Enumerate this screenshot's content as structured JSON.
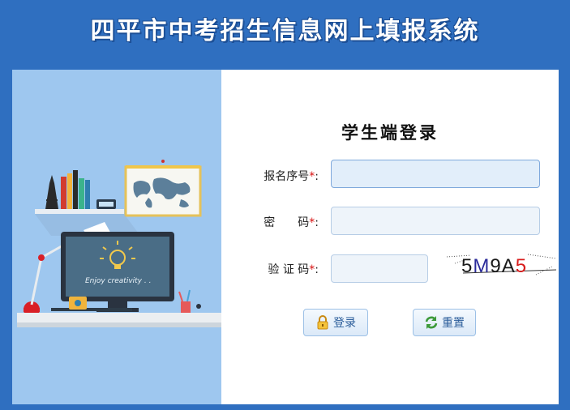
{
  "page": {
    "title": "四平市中考招生信息网上填报系统"
  },
  "illustration": {
    "monitor_text": "Enjoy creativity . ."
  },
  "login": {
    "title": "学生端登录",
    "fields": {
      "reg_no": {
        "label": "报名序号",
        "required_mark": "*",
        "suffix": ":",
        "value": ""
      },
      "password": {
        "label": "密　　码",
        "required_mark": "*",
        "suffix": ":",
        "value": ""
      },
      "captcha": {
        "label": "验 证 码",
        "required_mark": "*",
        "suffix": ":",
        "value": ""
      }
    },
    "captcha_text": "5M9A5",
    "buttons": {
      "login": "登录",
      "reset": "重置"
    }
  },
  "colors": {
    "header_bg": "#2f6fc0",
    "input_bg": "#eef4fa",
    "button_text": "#2b5d9a",
    "required": "#d81010"
  },
  "icons": {
    "login": "lock-icon",
    "reset": "refresh-icon"
  }
}
